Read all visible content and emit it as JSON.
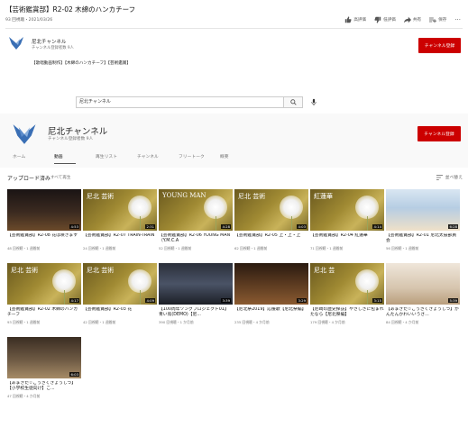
{
  "video": {
    "title": "【芸術鑑賞部】R2-02 木綿のハンカチーフ",
    "meta": "93 回視聴・2021/03/26",
    "actions": [
      {
        "label": "高評価",
        "icon": "thumbs-up-icon"
      },
      {
        "label": "低評価",
        "icon": "thumbs-down-icon"
      },
      {
        "label": "共有",
        "icon": "share-icon"
      },
      {
        "label": "保存",
        "icon": "save-playlist-icon"
      }
    ],
    "channel_name": "尼北チャンネル",
    "channel_sub": "チャンネル登録者数 9人",
    "subscribe_label": "チャンネル登録",
    "hashtags": "【歌唱動画制作】【木綿のハンカチーフ】【芸術鑑賞】"
  },
  "search": {
    "value": "尼北チャンネル"
  },
  "channel": {
    "name": "尼北チャンネル",
    "subscribers": "チャンネル登録者数 9人",
    "subscribe_label": "チャンネル登録",
    "tabs": [
      "ホーム",
      "動画",
      "再生リスト",
      "チャンネル",
      "フリートーク",
      "概要"
    ],
    "active_tab": 1
  },
  "uploads": {
    "title": "アップロード済み",
    "play_all": "すべて再生",
    "sort_label": "並べ替え"
  },
  "videos": [
    {
      "title": "【芸術鑑賞部】R2-08 花は咲きます",
      "meta": "48 回視聴・1 週間前",
      "duration": "4:53",
      "thumb": "concert",
      "overlay": ""
    },
    {
      "title": "【芸術鑑賞部】R2-07 TRAIN-TRAIN",
      "meta": "24 回視聴・1 週間前",
      "duration": "2:31",
      "thumb": "dandelion",
      "overlay": "尼北 芸術"
    },
    {
      "title": "【芸術鑑賞部】R2-06 YOUNG MAN（Y.M.C.A",
      "meta": "52 回視聴・1 週間前",
      "duration": "4:28",
      "thumb": "dandelion",
      "overlay": "YOUNG MAN"
    },
    {
      "title": "【芸術鑑賞部】R2-05 上・上・上",
      "meta": "62 回視聴・1 週間前",
      "duration": "4:03",
      "thumb": "dandelion",
      "overlay": "尼北 芸術"
    },
    {
      "title": "【芸術鑑賞部】R2-04 紅蓮華",
      "meta": "71 回視聴・1 週間前",
      "duration": "4:14",
      "thumb": "dandelion",
      "overlay": "紅蓮華"
    },
    {
      "title": "【芸術鑑賞部】R2-01 尼北太鼓部員会",
      "meta": "56 回視聴・1 週間前",
      "duration": "6:28",
      "thumb": "classroom",
      "overlay": ""
    },
    {
      "title": "【芸術鑑賞部】R2-02 木綿のハンカチーフ",
      "meta": "93 回視聴・1 週間前",
      "duration": "4:17",
      "thumb": "dandelion",
      "overlay": "尼北 芸術"
    },
    {
      "title": "【芸術鑑賞部】R2-03 花",
      "meta": "42 回視聴・1 週間前",
      "duration": "4:09",
      "thumb": "dandelion",
      "overlay": "尼北 芸術"
    },
    {
      "title": "【100周年ソングプロジェクト01】青い鳥(DEMO)【尼...",
      "meta": "390 回視聴・1 か月前",
      "duration": "3:39",
      "thumb": "stage",
      "overlay": ""
    },
    {
      "title": "【尼北祭2019】応援歌【尼北祭編】",
      "meta": "235 回視聴・4 か月前",
      "duration": "3:29",
      "thumb": "festival",
      "overlay": ""
    },
    {
      "title": "【尼崎の歴史探訪】やさしさに包まれたなら【尼北祭編】",
      "meta": "179 回視聴・4 か月前",
      "duration": "3:15",
      "thumb": "dandelion",
      "overlay": "尼北 芸"
    },
    {
      "title": "【あまきた☆ごうさくきょうしつ】かんたんかわいいうさ...",
      "meta": "84 回視聴・4 か月前",
      "duration": "5:39",
      "thumb": "dessert",
      "overlay": ""
    },
    {
      "title": "【あまきた☆ごうさくきょうしつ】【小学校生徒向け】こ...",
      "meta": "47 回視聴・4 か月前",
      "duration": "6:03",
      "thumb": "teacup",
      "overlay": ""
    }
  ]
}
